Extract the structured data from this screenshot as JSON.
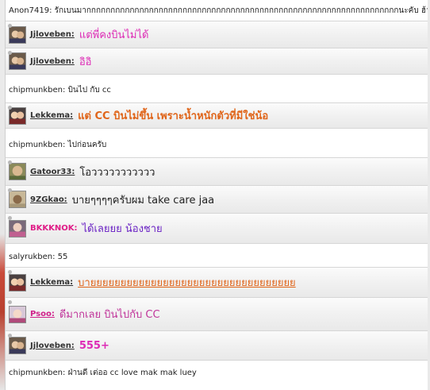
{
  "messages": [
    {
      "user": "Anon7419:",
      "text": "รักเบนมากกกกกกกกกกกกกกกกกกกกกกกกกกกกกกกกกกกกกกกกกกกกกกกกกกกกกกกกกกกกกกกกกนะคับ ฮ้า"
    },
    {
      "user": "Jjloveben:",
      "text": "แต่พี่คงบินไม่ได้"
    },
    {
      "user": "Jjloveben:",
      "text": "อิอิ"
    },
    {
      "user": "chipmunkben:",
      "text": "บินไป กับ cc"
    },
    {
      "user": "Lekkema:",
      "text": "แต่ CC บินไม่ขึ้น เพราะน้ำหนักตัวที่มีใช่น้อ"
    },
    {
      "user": "chipmunkben:",
      "text": "ไปก่อนครับ"
    },
    {
      "user": "Gatoor33:",
      "text": "โอววววววววววว"
    },
    {
      "user": "9ZGkao:",
      "text": "บายๆๆๆๆครับผม take care jaa"
    },
    {
      "user": "BKKKNOK:",
      "text": "ได้เลยยย น้องชาย"
    },
    {
      "user": "salyrukben:",
      "text": "55"
    },
    {
      "user": "Lekkema:",
      "text": "บายยยยยยยยยยยยยยยยยยยยยยยยยยยยยยยยยย"
    },
    {
      "user": "Psoo:",
      "text": "ดีมากเลย บินไปกับ CC"
    },
    {
      "user": "Jjloveben:",
      "text": "555+"
    },
    {
      "user": "chipmunkben:",
      "text": "ฝ่านดี เต่ออ cc love mak mak luey"
    }
  ],
  "colors": {
    "magenta": "#dd2ab5",
    "orange": "#e0651a",
    "purple": "#6a22c4",
    "plum": "#c0359a",
    "username_pink": "#d0208a"
  }
}
